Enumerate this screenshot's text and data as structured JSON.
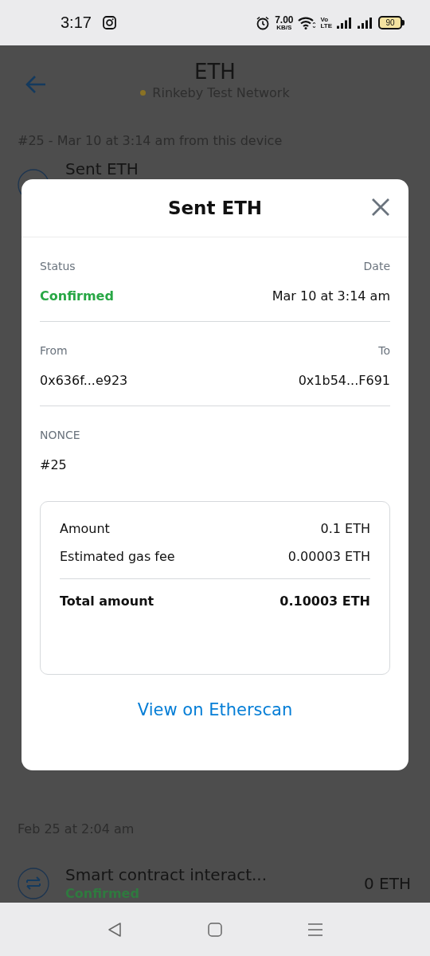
{
  "status_bar": {
    "time": "3:17",
    "speed": "7.00",
    "speed_unit": "KB/S",
    "volte_top": "Vo",
    "volte_bottom": "LTE",
    "battery": "90"
  },
  "header": {
    "title": "ETH",
    "network": "Rinkeby Test Network"
  },
  "background_list": {
    "top_label": "#25 - Mar 10 at 3:14 am from this device",
    "top_row_title": "Sent ETH",
    "bottom_label": "Feb 25 at 2:04 am",
    "bottom_row": {
      "title": "Smart contract interact...",
      "status": "Confirmed",
      "amount": "0 ETH"
    }
  },
  "modal": {
    "title": "Sent ETH",
    "status_label": "Status",
    "status": "Confirmed",
    "date_label": "Date",
    "date": "Mar 10 at 3:14 am",
    "from_label": "From",
    "from": "0x636f...e923",
    "to_label": "To",
    "to": "0x1b54...F691",
    "nonce_label": "NONCE",
    "nonce": "#25",
    "summary": [
      {
        "label": "Amount",
        "value": "0.1 ETH",
        "kind": "line"
      },
      {
        "label": "Estimated gas fee",
        "value": "0.00003 ETH",
        "kind": "line"
      },
      {
        "label": "Total amount",
        "value": "0.10003 ETH",
        "kind": "total"
      }
    ],
    "link": "View on Etherscan"
  }
}
